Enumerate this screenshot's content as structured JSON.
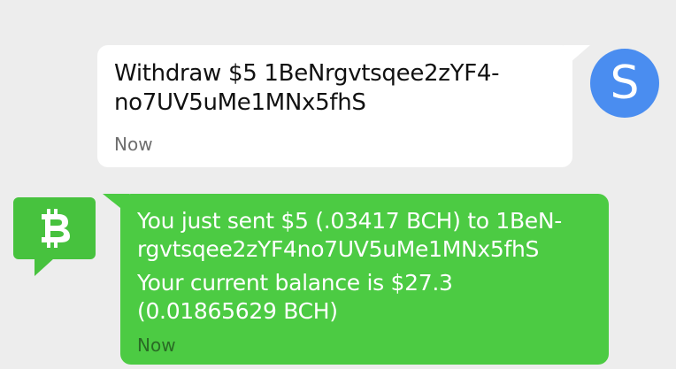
{
  "conversation": {
    "outgoing": {
      "text": "Withdraw $5 1BeNrgvtsqee2zYF4-\nno7UV5uMe1MNx5fhS",
      "time": "Now",
      "avatar_letter": "S",
      "avatar_color": "#4a8df0"
    },
    "incoming": {
      "icon": "bitcoin-icon",
      "line1": "You just sent $5 (.03417 BCH) to 1BeN-\nrgvtsqee2zYF4no7UV5uMe1MNx5fhS",
      "line2": "Your current balance is $27.3\n(0.01865629 BCH)",
      "time": "Now",
      "bubble_color": "#4ccb43"
    }
  }
}
